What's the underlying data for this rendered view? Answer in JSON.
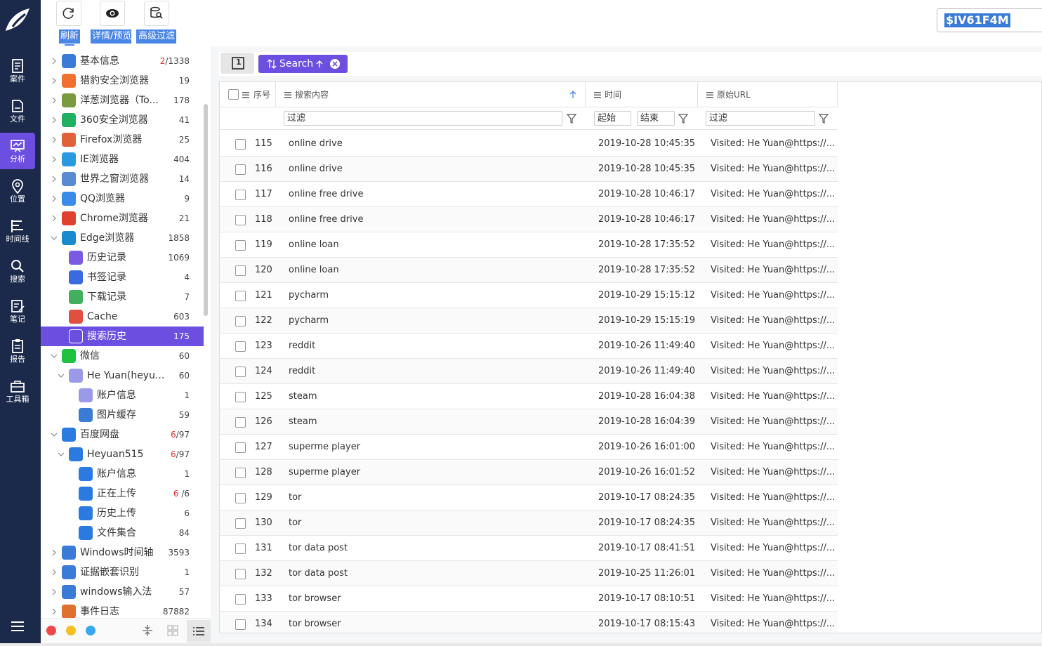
{
  "nav": {
    "items": [
      {
        "label": "案件",
        "icon": "case-icon"
      },
      {
        "label": "文件",
        "icon": "file-icon"
      },
      {
        "label": "分析",
        "icon": "analysis-icon"
      },
      {
        "label": "位置",
        "icon": "location-icon"
      },
      {
        "label": "时间线",
        "icon": "timeline-icon"
      },
      {
        "label": "搜索",
        "icon": "search-icon"
      },
      {
        "label": "笔记",
        "icon": "note-icon"
      },
      {
        "label": "报告",
        "icon": "report-icon"
      },
      {
        "label": "工具箱",
        "icon": "toolbox-icon"
      }
    ],
    "active_index": 2
  },
  "toolbar": {
    "refresh_label": "刷新",
    "details_label": "详情/预览",
    "filter_label": "高级过滤"
  },
  "tree": [
    {
      "label": "基本信息",
      "count_red": "2",
      "count": "/1338",
      "icon": "basic-info-icon",
      "color": "#3a7bd5"
    },
    {
      "label": "猎豹安全浏览器",
      "count": "19",
      "icon": "cheetah-browser-icon",
      "color": "#f07030"
    },
    {
      "label": "洋葱浏览器（To...",
      "count": "178",
      "icon": "onion-browser-icon",
      "color": "#7a9a40"
    },
    {
      "label": "360安全浏览器",
      "count": "41",
      "icon": "360-browser-icon",
      "color": "#20b060"
    },
    {
      "label": "Firefox浏览器",
      "count": "25",
      "icon": "firefox-icon",
      "color": "#e0603a"
    },
    {
      "label": "IE浏览器",
      "count": "404",
      "icon": "ie-icon",
      "color": "#2a9ae0"
    },
    {
      "label": "世界之窗浏览器",
      "count": "14",
      "icon": "theworld-browser-icon",
      "color": "#5a8ad0"
    },
    {
      "label": "QQ浏览器",
      "count": "9",
      "icon": "qq-browser-icon",
      "color": "#3a8ae8"
    },
    {
      "label": "Chrome浏览器",
      "count": "21",
      "icon": "chrome-icon",
      "color": "#e04030"
    },
    {
      "label": "Edge浏览器",
      "count": "1858",
      "icon": "edge-icon",
      "color": "#1a8ad0"
    },
    {
      "label": "历史记录",
      "count": "1069",
      "icon": "history-icon",
      "color": "#7a5ae0"
    },
    {
      "label": "书签记录",
      "count": "4",
      "icon": "bookmark-icon",
      "color": "#3a6ae0"
    },
    {
      "label": "下载记录",
      "count": "7",
      "icon": "download-icon",
      "color": "#40b060"
    },
    {
      "label": "Cache",
      "count": "603",
      "icon": "cache-icon",
      "color": "#e05040"
    },
    {
      "label": "搜索历史",
      "count": "175",
      "icon": "search-history-icon",
      "color": "#ffffff"
    },
    {
      "label": "微信",
      "count": "60",
      "icon": "wechat-icon",
      "color": "#20c040"
    },
    {
      "label": "He Yuan(heyu...",
      "count": "60",
      "icon": "user-avatar-icon",
      "color": "#9a9ae8"
    },
    {
      "label": "账户信息",
      "count": "1",
      "icon": "account-icon",
      "color": "#9a9ae8"
    },
    {
      "label": "图片缓存",
      "count": "59",
      "icon": "image-cache-icon",
      "color": "#3a7bd5"
    },
    {
      "label": "百度网盘",
      "count_red": "6",
      "count": "/97",
      "icon": "baidu-netdisk-icon",
      "color": "#2a7ae0"
    },
    {
      "label": "Heyuan515",
      "count_red": "6",
      "count": "/97",
      "icon": "netdisk-user-icon",
      "color": "#2a7ae0"
    },
    {
      "label": "账户信息",
      "count": "1",
      "icon": "netdisk-account-icon",
      "color": "#2a7ae0"
    },
    {
      "label": "正在上传",
      "count_red": "6",
      "count": " /6",
      "icon": "uploading-icon",
      "color": "#2a7ae0"
    },
    {
      "label": "历史上传",
      "count": "6",
      "icon": "upload-history-icon",
      "color": "#2a7ae0"
    },
    {
      "label": "文件集合",
      "count": "84",
      "icon": "file-collection-icon",
      "color": "#2a7ae0"
    },
    {
      "label": "Windows时间轴",
      "count": "3593",
      "icon": "windows-timeline-icon",
      "color": "#3a7bd5"
    },
    {
      "label": "证据嵌套识别",
      "count": "1",
      "icon": "evidence-nesting-icon",
      "color": "#3a7bd5"
    },
    {
      "label": "windows输入法",
      "count": "57",
      "icon": "ime-icon",
      "color": "#3a7bd5"
    },
    {
      "label": "事件日志",
      "count": "87882",
      "icon": "event-log-icon",
      "color": "#e07030"
    }
  ],
  "search_value": "$IV61F4M",
  "tabs": {
    "tab1_label": "1",
    "search_label": "Search"
  },
  "grid": {
    "headers": {
      "seq": "序号",
      "content": "搜索内容",
      "time": "时间",
      "url": "原始URL"
    },
    "filter_placeholder": "过滤",
    "start_placeholder": "起始",
    "end_placeholder": "结束",
    "rows": [
      {
        "seq": "115",
        "content": "online drive",
        "time": "2019-10-28 10:45:35",
        "url": "Visited: He Yuan@https://..."
      },
      {
        "seq": "116",
        "content": "online drive",
        "time": "2019-10-28 10:45:35",
        "url": "Visited: He Yuan@https://..."
      },
      {
        "seq": "117",
        "content": "online free drive",
        "time": "2019-10-28 10:46:17",
        "url": "Visited: He Yuan@https://..."
      },
      {
        "seq": "118",
        "content": "online free drive",
        "time": "2019-10-28 10:46:17",
        "url": "Visited: He Yuan@https://..."
      },
      {
        "seq": "119",
        "content": "online loan",
        "time": "2019-10-28 17:35:52",
        "url": "Visited: He Yuan@https://..."
      },
      {
        "seq": "120",
        "content": "online loan",
        "time": "2019-10-28 17:35:52",
        "url": "Visited: He Yuan@https://..."
      },
      {
        "seq": "121",
        "content": "pycharm",
        "time": "2019-10-29 15:15:12",
        "url": "Visited: He Yuan@https://..."
      },
      {
        "seq": "122",
        "content": "pycharm",
        "time": "2019-10-29 15:15:19",
        "url": "Visited: He Yuan@https://..."
      },
      {
        "seq": "123",
        "content": "reddit",
        "time": "2019-10-26 11:49:40",
        "url": "Visited: He Yuan@https://..."
      },
      {
        "seq": "124",
        "content": "reddit",
        "time": "2019-10-26 11:49:40",
        "url": "Visited: He Yuan@https://..."
      },
      {
        "seq": "125",
        "content": "steam",
        "time": "2019-10-28 16:04:38",
        "url": "Visited: He Yuan@https://..."
      },
      {
        "seq": "126",
        "content": "steam",
        "time": "2019-10-28 16:04:39",
        "url": "Visited: He Yuan@https://..."
      },
      {
        "seq": "127",
        "content": "superme player",
        "time": "2019-10-26 16:01:00",
        "url": "Visited: He Yuan@https://..."
      },
      {
        "seq": "128",
        "content": "superme player",
        "time": "2019-10-26 16:01:52",
        "url": "Visited: He Yuan@https://..."
      },
      {
        "seq": "129",
        "content": "tor",
        "time": "2019-10-17 08:24:35",
        "url": "Visited: He Yuan@https://..."
      },
      {
        "seq": "130",
        "content": "tor",
        "time": "2019-10-17 08:24:35",
        "url": "Visited: He Yuan@https://..."
      },
      {
        "seq": "131",
        "content": "tor data post",
        "time": "2019-10-17 08:41:51",
        "url": "Visited: He Yuan@https://..."
      },
      {
        "seq": "132",
        "content": "tor data post",
        "time": "2019-10-25 11:26:01",
        "url": "Visited: He Yuan@https://..."
      },
      {
        "seq": "133",
        "content": "tor browser",
        "time": "2019-10-17 08:10:51",
        "url": "Visited: He Yuan@https://..."
      },
      {
        "seq": "134",
        "content": "tor browser",
        "time": "2019-10-17 08:15:43",
        "url": "Visited: He Yuan@https://..."
      }
    ]
  },
  "colors": {
    "accent": "#6c4fe0",
    "nav_bg": "#1b2a4a",
    "highlight": "#4a86e8"
  }
}
